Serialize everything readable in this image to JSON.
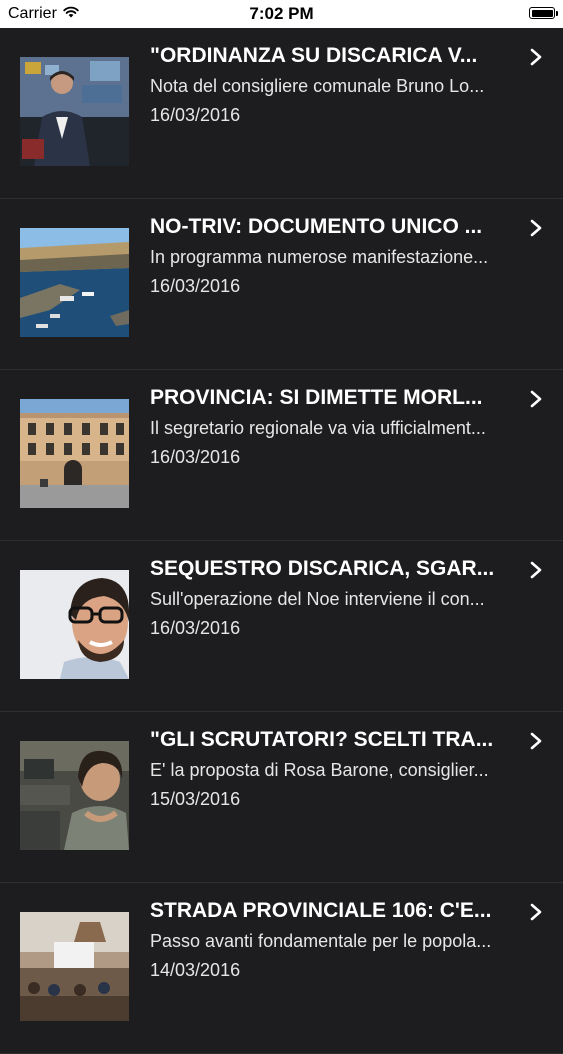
{
  "status_bar": {
    "carrier": "Carrier",
    "time": "7:02 PM",
    "battery_level": 1.0
  },
  "icons": {
    "wifi": "wifi-icon",
    "battery": "battery-icon",
    "chevron": "chevron-right-icon"
  },
  "colors": {
    "background": "#1d1d1f",
    "text": "#ffffff",
    "separator": "#2f2f31"
  },
  "articles": [
    {
      "title": "\"ORDINANZA SU DISCARICA V...",
      "subtitle": "Nota del consigliere comunale Bruno Lo...",
      "date": "16/03/2016"
    },
    {
      "title": "NO-TRIV: DOCUMENTO UNICO ...",
      "subtitle": "In programma numerose manifestazione...",
      "date": "16/03/2016"
    },
    {
      "title": "PROVINCIA: SI DIMETTE MORL...",
      "subtitle": "Il segretario regionale va via ufficialment...",
      "date": "16/03/2016"
    },
    {
      "title": "SEQUESTRO DISCARICA, SGAR...",
      "subtitle": "Sull'operazione del Noe interviene il con...",
      "date": "16/03/2016"
    },
    {
      "title": "\"GLI SCRUTATORI? SCELTI TRA...",
      "subtitle": "E' la proposta di Rosa Barone, consiglier...",
      "date": "15/03/2016"
    },
    {
      "title": "STRADA PROVINCIALE 106: C'E...",
      "subtitle": "Passo avanti fondamentale per le popola...",
      "date": "14/03/2016"
    }
  ]
}
